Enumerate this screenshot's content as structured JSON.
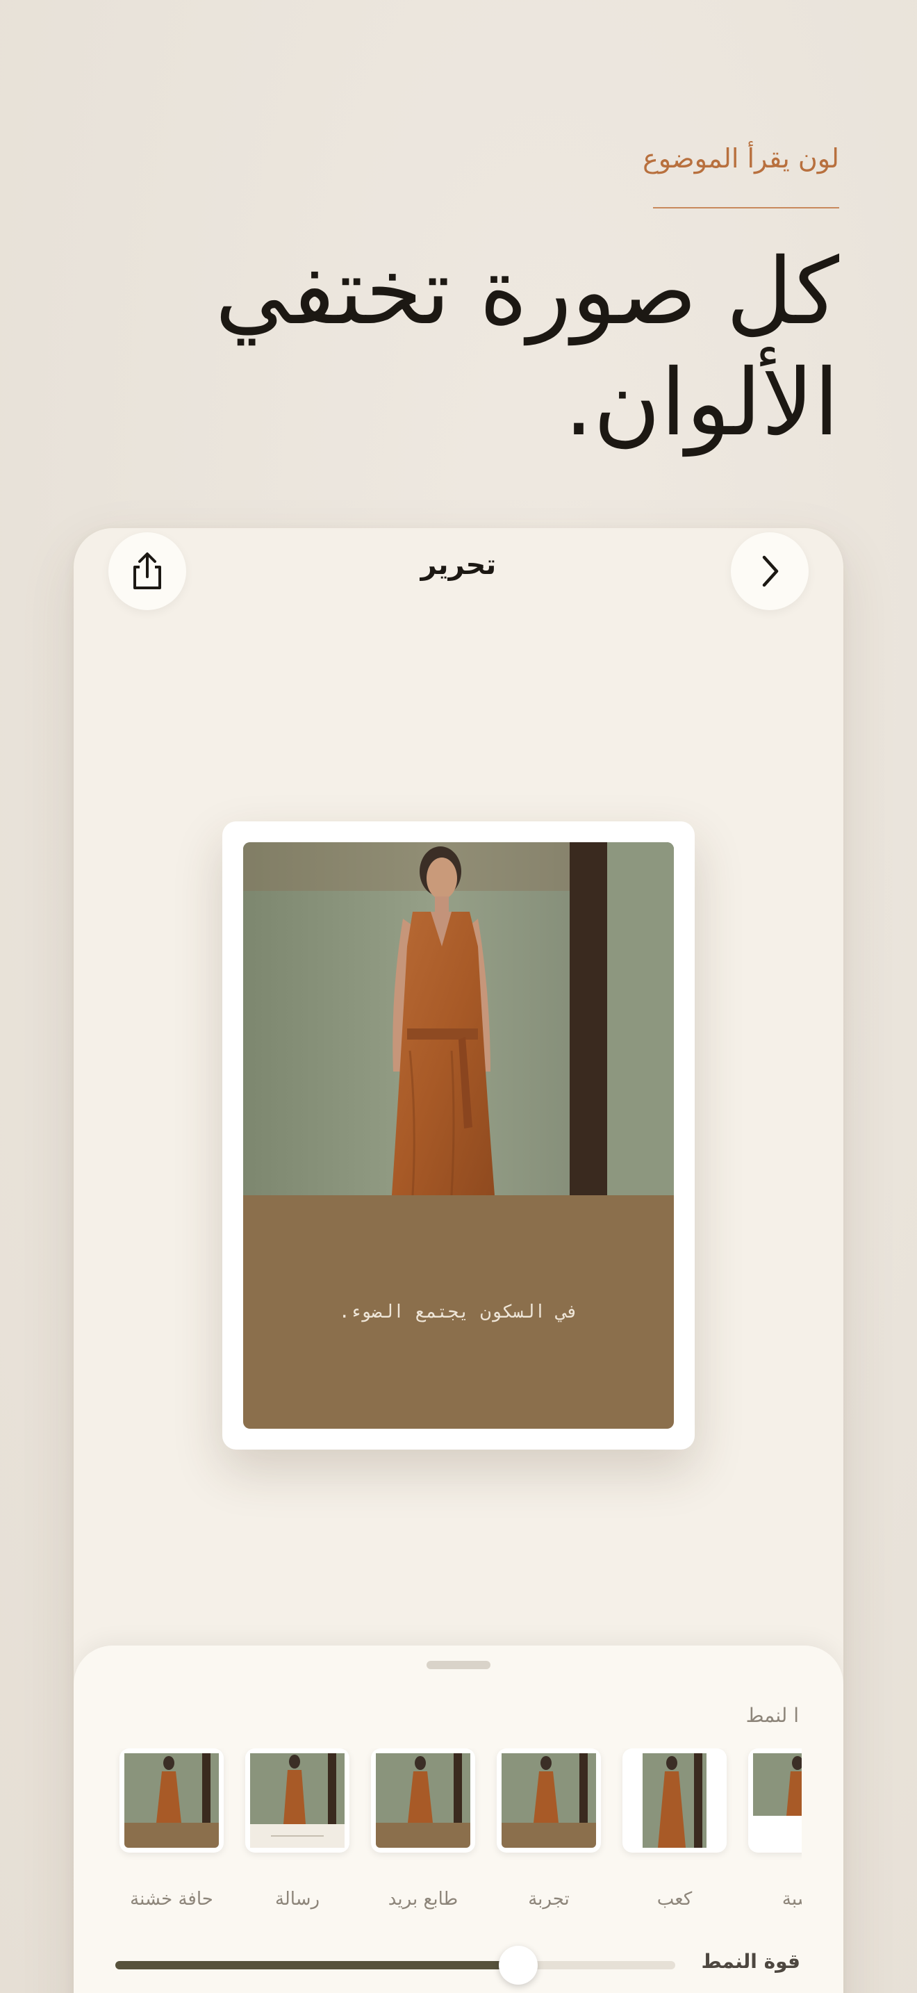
{
  "hero": {
    "eyebrow": "لون يقرأ الموضوع",
    "headline": "كل صورة تختفي\nالألوان."
  },
  "editor": {
    "title": "تحرير",
    "share_icon": "share-icon",
    "next_icon": "chevron-right-icon"
  },
  "artwork": {
    "caption": "في السكون يجتمع الضوء."
  },
  "sheet": {
    "section_label": "ا لنمط",
    "styles": [
      {
        "label": "حافة خشنة",
        "variant": "rough"
      },
      {
        "label": "رسالة",
        "variant": "letter"
      },
      {
        "label": "طابع بريد",
        "variant": "stamp"
      },
      {
        "label": "تجربة",
        "variant": "proof"
      },
      {
        "label": "كعب",
        "variant": "stub"
      },
      {
        "label": "نسبة",
        "variant": "ratio"
      }
    ],
    "strength_label": "قوة النمط",
    "strength_value": 0.72
  },
  "colors": {
    "accent": "#b8703e",
    "caption_bg": "#8b6f4c",
    "slider_fill": "#57523c"
  }
}
